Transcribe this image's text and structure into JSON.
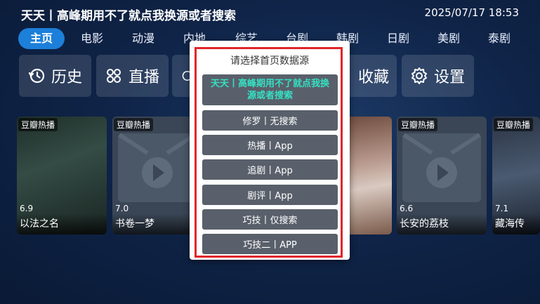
{
  "header": {
    "title": "天天丨高峰期用不了就点我换源或者搜索",
    "datetime": "2025/07/17 18:53"
  },
  "tabs": [
    "主页",
    "电影",
    "动漫",
    "内地",
    "综艺",
    "台剧",
    "韩剧",
    "日剧",
    "美剧",
    "泰剧"
  ],
  "active_tab": "主页",
  "tiles": {
    "history": {
      "label": "历史",
      "icon": "history-icon"
    },
    "live": {
      "label": "直播",
      "icon": "live-icon"
    },
    "favorites": {
      "label": "收藏",
      "icon": "star-icon"
    },
    "settings": {
      "label": "设置",
      "icon": "gear-icon"
    }
  },
  "cards": [
    {
      "badge": "豆瓣热播",
      "rating": "6.9",
      "title": "以法之名"
    },
    {
      "badge": "豆瓣热播",
      "rating": "7.0",
      "title": "书卷一梦"
    },
    {
      "badge": "",
      "rating": "",
      "title": ""
    },
    {
      "badge": "豆瓣热播",
      "rating": "6.6",
      "title": "长安的荔枝"
    },
    {
      "badge": "豆瓣热播",
      "rating": "7.1",
      "title": "藏海传"
    }
  ],
  "dialog": {
    "title": "请选择首页数据源",
    "options": [
      {
        "label": "天天丨高峰期用不了就点我换源或者搜索",
        "selected": true
      },
      {
        "label": "修罗丨无搜索",
        "selected": false
      },
      {
        "label": "热播丨App",
        "selected": false
      },
      {
        "label": "追剧丨App",
        "selected": false
      },
      {
        "label": "剧评丨App",
        "selected": false
      },
      {
        "label": "巧技丨仅搜索",
        "selected": false
      },
      {
        "label": "巧技二丨APP",
        "selected": false
      }
    ]
  },
  "colors": {
    "accent": "#1c7fd9",
    "selected_text": "#35e0c4",
    "highlight_outline": "#e0262a"
  }
}
